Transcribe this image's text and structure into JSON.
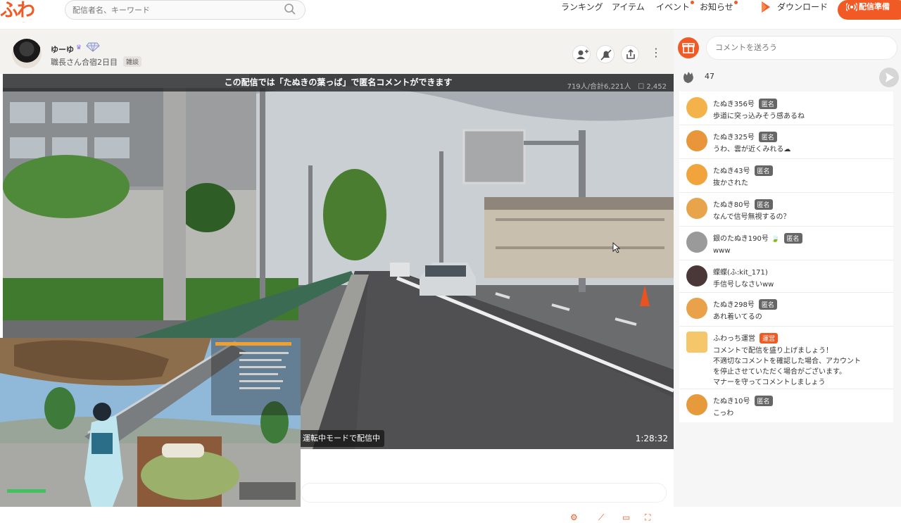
{
  "header": {
    "logo_text": "ふわっち",
    "search_placeholder": "配信者名、キーワード",
    "nav": [
      {
        "label": "ランキング",
        "dot": false
      },
      {
        "label": "アイテム",
        "dot": false
      },
      {
        "label": "イベント",
        "dot": true
      },
      {
        "label": "お知らせ",
        "dot": true
      }
    ],
    "download_label": "ダウンロード",
    "live_button_label": "配信準備"
  },
  "streamer": {
    "name": "ゆーゆ",
    "title": "職長さん合宿2日目",
    "tag": "雑談"
  },
  "video": {
    "banner": "この配信では「たぬきの葉っぱ」で匿名コメントができます",
    "viewers": "719人/合計6,221人",
    "comment_count": "2,452",
    "driving_label": "運転中モードで配信中",
    "duration": "1:28:32"
  },
  "side": {
    "comment_placeholder": "コメントを送ろう",
    "clap_count": "47",
    "comments": [
      {
        "name": "たぬき356号",
        "badge": "匿名",
        "text": "歩道に突っ込みそう感あるね",
        "color": "#f3b24a"
      },
      {
        "name": "たぬき325号",
        "badge": "匿名",
        "text": "うわ、雲が近くみれる☁",
        "color": "#e9953a"
      },
      {
        "name": "たぬき43号",
        "badge": "匿名",
        "text": "抜かされた",
        "color": "#f1a43c"
      },
      {
        "name": "たぬき80号",
        "badge": "匿名",
        "text": "なんで信号無視するの？",
        "color": "#e8a44a"
      },
      {
        "name": "銀のたぬき190号",
        "badge": "匿名",
        "text": "www",
        "color": "#9a9a9a"
      },
      {
        "name": "蝶蝶(ふ:kit_171)",
        "badge": "",
        "text": "手信号しなさいww",
        "color": "#4a3838"
      },
      {
        "name": "たぬき298号",
        "badge": "匿名",
        "text": "あれ着いてるの",
        "color": "#eaa24a"
      },
      {
        "name": "ふわっち運営",
        "badge": "運営",
        "text": "コメントで配信を盛り上げましょう！\n不適切なコメントを確認した場合、アカウント\nを停止させていただく場合がございます。\nマナーを守ってコメントしましょう",
        "color": "#f5c76a"
      },
      {
        "name": "たぬき10号",
        "badge": "匿名",
        "text": "こっわ",
        "color": "#e79a3c"
      }
    ]
  },
  "colors": {
    "accent": "#f15a24",
    "badge_gray": "#666666"
  }
}
